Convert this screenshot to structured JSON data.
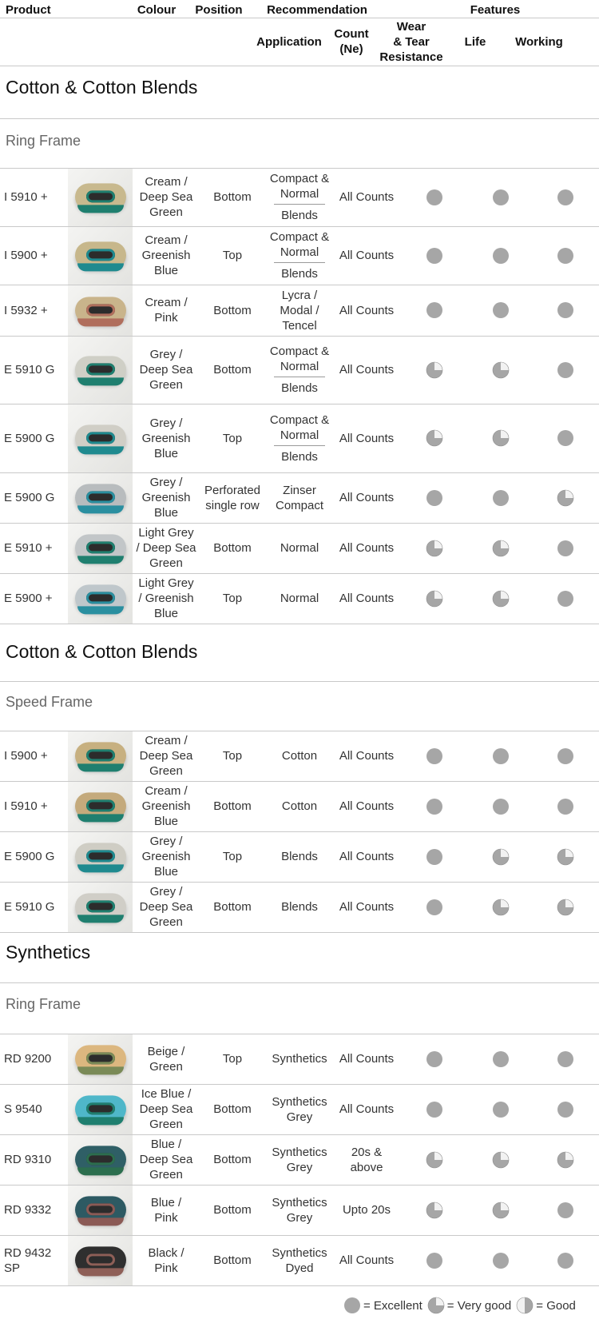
{
  "header": {
    "product": "Product",
    "colour": "Colour",
    "position": "Position",
    "recommendation": "Recommendation",
    "features": "Features",
    "application": "Application",
    "count_line1": "Count",
    "count_line2": "(Ne)",
    "wear_line1": "Wear",
    "wear_line2": "& Tear",
    "wear_line3": "Resistance",
    "life": "Life",
    "working": "Working"
  },
  "rating_colors": {
    "fill": "#a6a6a6",
    "light": "#f2f2f2",
    "stroke": "#8c8c8c"
  },
  "sections": [
    {
      "title": "Cotton & Cotton Blends",
      "subtitle": "Ring Frame",
      "rows": [
        {
          "product": "I 5910 +",
          "colour": [
            "Cream /",
            "Deep Sea",
            "Green"
          ],
          "position": [
            "Bottom"
          ],
          "application": {
            "split": true,
            "top": [
              "Compact &",
              "Normal"
            ],
            "bottom": [
              "Blends"
            ]
          },
          "count": [
            "All Counts"
          ],
          "wear": "excellent",
          "life": "excellent",
          "working": "excellent",
          "belt": {
            "outer": "#c8b98e",
            "inner": "#1f7f6f"
          }
        },
        {
          "product": "I 5900 +",
          "colour": [
            "Cream /",
            "Greenish",
            "Blue"
          ],
          "position": [
            "Top"
          ],
          "application": {
            "split": true,
            "top": [
              "Compact &",
              "Normal"
            ],
            "bottom": [
              "Blends"
            ]
          },
          "count": [
            "All Counts"
          ],
          "wear": "excellent",
          "life": "excellent",
          "working": "excellent",
          "belt": {
            "outer": "#c7b78b",
            "inner": "#1f8a8f"
          }
        },
        {
          "product": "I 5932 +",
          "colour": [
            "Cream /",
            "Pink"
          ],
          "position": [
            "Bottom"
          ],
          "application": {
            "split": false,
            "lines": [
              "Lycra /",
              "Modal /",
              "Tencel"
            ]
          },
          "count": [
            "All Counts"
          ],
          "wear": "excellent",
          "life": "excellent",
          "working": "excellent",
          "belt": {
            "outer": "#c9b48b",
            "inner": "#b06e5c"
          }
        },
        {
          "product": "E 5910 G",
          "colour": [
            "Grey /",
            "Deep Sea",
            "Green"
          ],
          "position": [
            "Bottom"
          ],
          "application": {
            "split": true,
            "top": [
              "Compact &",
              "Normal"
            ],
            "bottom": [
              "Blends"
            ]
          },
          "count": [
            "All Counts"
          ],
          "wear": "verygood",
          "life": "verygood",
          "working": "excellent",
          "belt": {
            "outer": "#cfcfc6",
            "inner": "#1f7f6f"
          }
        },
        {
          "product": "E 5900 G",
          "colour": [
            "Grey /",
            "Greenish",
            "Blue"
          ],
          "position": [
            "Top"
          ],
          "application": {
            "split": true,
            "top": [
              "Compact &",
              "Normal"
            ],
            "bottom": [
              "Blends"
            ]
          },
          "count": [
            "All Counts"
          ],
          "wear": "verygood",
          "life": "verygood",
          "working": "excellent",
          "belt": {
            "outer": "#d0cec6",
            "inner": "#1f8a8f"
          }
        },
        {
          "product": "E 5900 G",
          "colour": [
            "Grey /",
            "Greenish",
            "Blue"
          ],
          "position": [
            "Perforated",
            "single row"
          ],
          "application": {
            "split": false,
            "lines": [
              "Zinser",
              "Compact"
            ]
          },
          "count": [
            "All Counts"
          ],
          "wear": "excellent",
          "life": "excellent",
          "working": "verygood",
          "belt": {
            "outer": "#b8bcbe",
            "inner": "#2a8fa0"
          }
        },
        {
          "product": "E 5910 +",
          "colour": [
            "Light Grey",
            "/ Deep Sea",
            "Green"
          ],
          "position": [
            "Bottom"
          ],
          "application": {
            "split": false,
            "lines": [
              "Normal"
            ]
          },
          "count": [
            "All Counts"
          ],
          "wear": "verygood",
          "life": "verygood",
          "working": "excellent",
          "belt": {
            "outer": "#c2c6c8",
            "inner": "#1f7f6f"
          }
        },
        {
          "product": "E 5900 +",
          "colour": [
            "Light Grey",
            "/ Greenish",
            "Blue"
          ],
          "position": [
            "Top"
          ],
          "application": {
            "split": false,
            "lines": [
              "Normal"
            ]
          },
          "count": [
            "All Counts"
          ],
          "wear": "verygood",
          "life": "verygood",
          "working": "excellent",
          "belt": {
            "outer": "#bfc7cb",
            "inner": "#2a8fa0"
          }
        }
      ]
    },
    {
      "title": "Cotton & Cotton Blends",
      "subtitle": "Speed Frame",
      "rows": [
        {
          "product": "I 5900 +",
          "colour": [
            "Cream /",
            "Deep Sea",
            "Green"
          ],
          "position": [
            "Top"
          ],
          "application": {
            "split": false,
            "lines": [
              "Cotton"
            ]
          },
          "count": [
            "All Counts"
          ],
          "wear": "excellent",
          "life": "excellent",
          "working": "excellent",
          "belt": {
            "outer": "#c7b080",
            "inner": "#1f7f6f"
          }
        },
        {
          "product": "I 5910 +",
          "colour": [
            "Cream /",
            "Greenish",
            "Blue"
          ],
          "position": [
            "Bottom"
          ],
          "application": {
            "split": false,
            "lines": [
              "Cotton"
            ]
          },
          "count": [
            "All Counts"
          ],
          "wear": "excellent",
          "life": "excellent",
          "working": "excellent",
          "belt": {
            "outer": "#c4aa7c",
            "inner": "#1f7f6f"
          }
        },
        {
          "product": "E 5900 G",
          "colour": [
            "Grey /",
            "Greenish",
            "Blue"
          ],
          "position": [
            "Top"
          ],
          "application": {
            "split": false,
            "lines": [
              "Blends"
            ]
          },
          "count": [
            "All Counts"
          ],
          "wear": "excellent",
          "life": "verygood",
          "working": "verygood",
          "belt": {
            "outer": "#cfcdc4",
            "inner": "#1f8a8f"
          }
        },
        {
          "product": "E 5910 G",
          "colour": [
            "Grey /",
            "Deep Sea",
            "Green"
          ],
          "position": [
            "Bottom"
          ],
          "application": {
            "split": false,
            "lines": [
              "Blends"
            ]
          },
          "count": [
            "All Counts"
          ],
          "wear": "excellent",
          "life": "verygood",
          "working": "verygood",
          "belt": {
            "outer": "#d0cec7",
            "inner": "#1f7f6f"
          }
        }
      ]
    },
    {
      "title": "Synthetics",
      "subtitle": "Ring Frame",
      "rows": [
        {
          "product": "RD 9200",
          "colour": [
            "Beige /",
            "Green"
          ],
          "position": [
            "Top"
          ],
          "application": {
            "split": false,
            "lines": [
              "Synthetics"
            ]
          },
          "count": [
            "All Counts"
          ],
          "wear": "excellent",
          "life": "excellent",
          "working": "excellent",
          "belt": {
            "outer": "#dcb77f",
            "inner": "#7a8a57"
          }
        },
        {
          "product": "S 9540",
          "colour": [
            "Ice Blue /",
            "Deep Sea",
            "Green"
          ],
          "position": [
            "Bottom"
          ],
          "application": {
            "split": false,
            "lines": [
              "Synthetics",
              "Grey"
            ]
          },
          "count": [
            "All Counts"
          ],
          "wear": "excellent",
          "life": "excellent",
          "working": "excellent",
          "belt": {
            "outer": "#4fb7c9",
            "inner": "#1f7f6f"
          }
        },
        {
          "product": "RD 9310",
          "colour": [
            "Blue /",
            "Deep Sea",
            "Green"
          ],
          "position": [
            "Bottom"
          ],
          "application": {
            "split": false,
            "lines": [
              "Synthetics",
              "Grey"
            ]
          },
          "count": [
            "20s &",
            "above"
          ],
          "wear": "verygood",
          "life": "verygood",
          "working": "verygood",
          "belt": {
            "outer": "#2f5f66",
            "inner": "#2c6e4e"
          }
        },
        {
          "product": "RD 9332",
          "colour": [
            "Blue /",
            "Pink"
          ],
          "position": [
            "Bottom"
          ],
          "application": {
            "split": false,
            "lines": [
              "Synthetics",
              "Grey"
            ]
          },
          "count": [
            "Upto 20s"
          ],
          "wear": "verygood",
          "life": "verygood",
          "working": "excellent",
          "belt": {
            "outer": "#2d5a63",
            "inner": "#8b5a55"
          }
        },
        {
          "product": "RD 9432 SP",
          "colour": [
            "Black /",
            "Pink"
          ],
          "position": [
            "Bottom"
          ],
          "application": {
            "split": false,
            "lines": [
              "Synthetics",
              "Dyed"
            ]
          },
          "count": [
            "All Counts"
          ],
          "wear": "excellent",
          "life": "excellent",
          "working": "excellent",
          "belt": {
            "outer": "#2f2f2f",
            "inner": "#8e5f57"
          }
        }
      ]
    }
  ],
  "legend": {
    "excellent": "= Excellent",
    "verygood": "= Very good",
    "good": "= Good"
  }
}
